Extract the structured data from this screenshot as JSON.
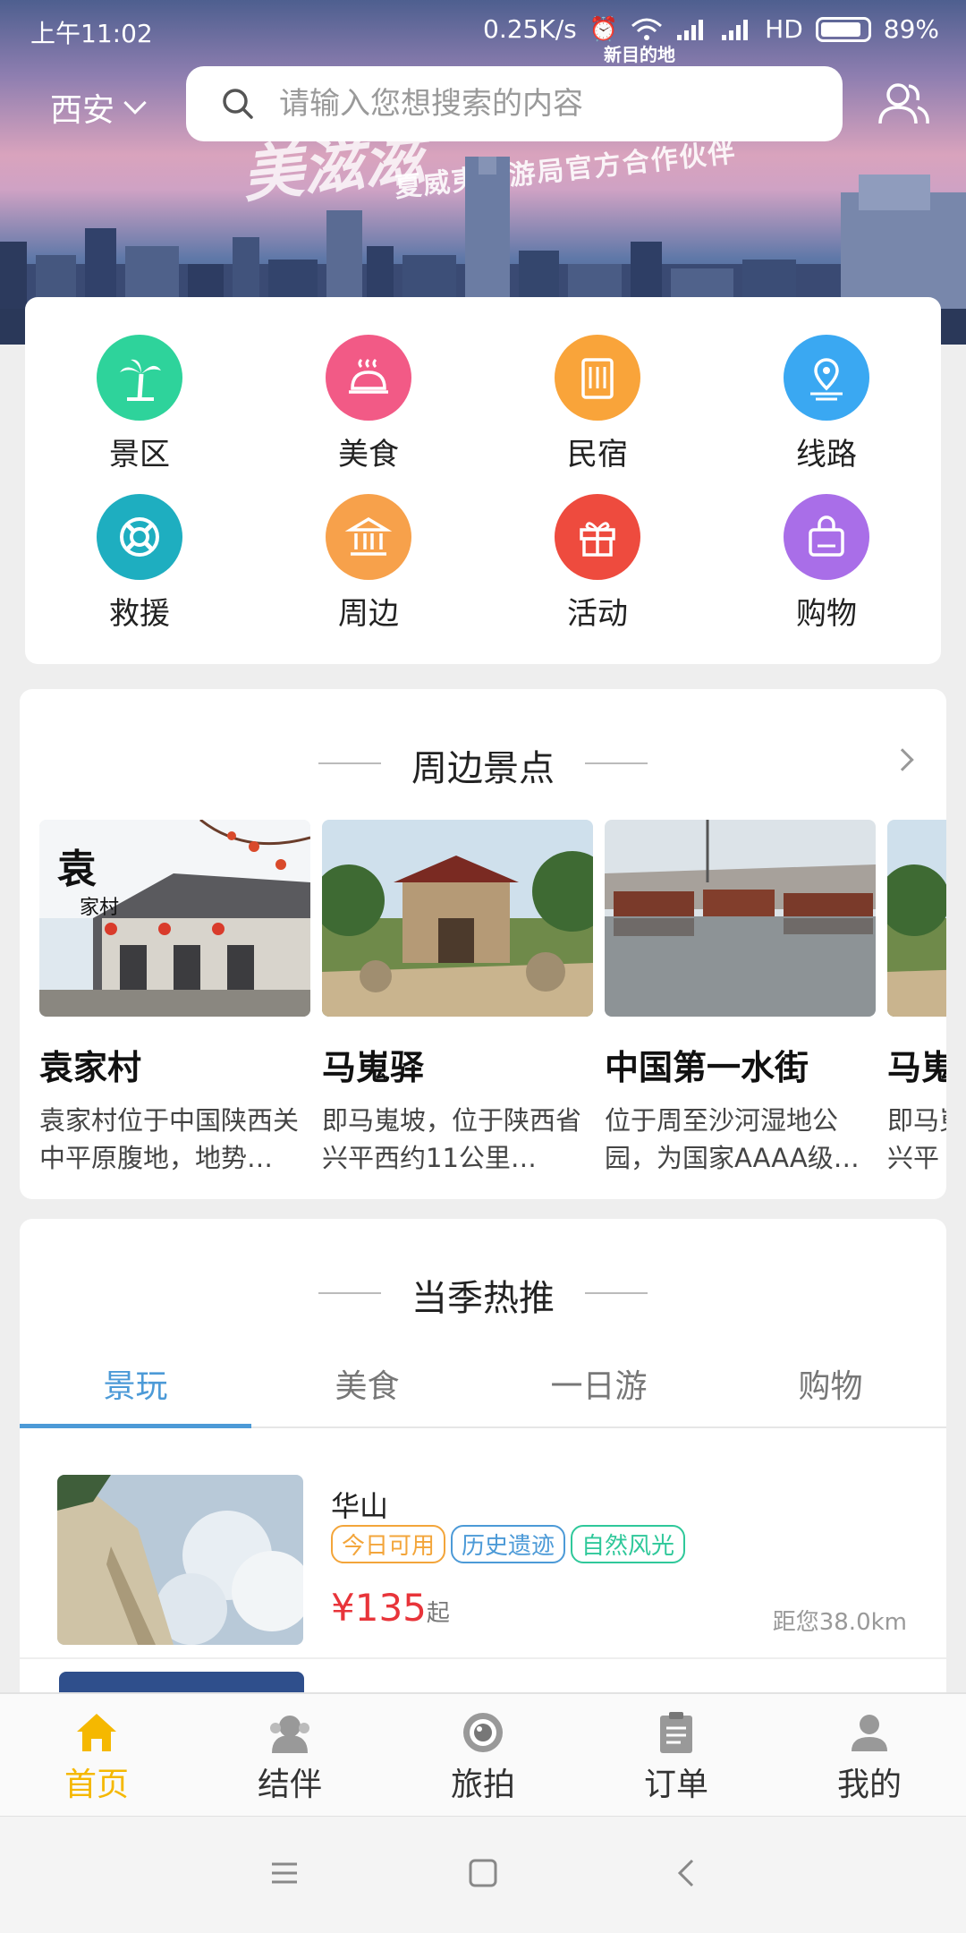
{
  "status_bar": {
    "time": "上午11:02",
    "network_speed": "0.25K/s",
    "hd": "HD",
    "battery": "89%"
  },
  "hero": {
    "banner_title": "美滋滋",
    "banner_slogan": "夏威夷旅游局官方合作伙伴",
    "banner_dest": "新目的地"
  },
  "header": {
    "city": "西安",
    "search_placeholder": "请输入您想搜索的内容"
  },
  "categories": [
    {
      "label": "景区",
      "color": "#2ed39b",
      "icon": "palm-tree-icon"
    },
    {
      "label": "美食",
      "color": "#f25a86",
      "icon": "dish-icon"
    },
    {
      "label": "民宿",
      "color": "#f9a43a",
      "icon": "building-icon"
    },
    {
      "label": "线路",
      "color": "#3aa8f2",
      "icon": "location-pin-icon"
    },
    {
      "label": "救援",
      "color": "#1eaec0",
      "icon": "lifebuoy-icon"
    },
    {
      "label": "周边",
      "color": "#f7a14b",
      "icon": "bank-icon"
    },
    {
      "label": "活动",
      "color": "#ee4b3e",
      "icon": "gift-icon"
    },
    {
      "label": "购物",
      "color": "#a96ee8",
      "icon": "shopping-bag-icon"
    }
  ],
  "nearby": {
    "title": "周边景点",
    "items": [
      {
        "name": "袁家村",
        "desc": "袁家村位于中国陕西关中平原腹地，地势…"
      },
      {
        "name": "马嵬驿",
        "desc": "即马嵬坡，位于陕西省兴平西约11公里…"
      },
      {
        "name": "中国第一水街",
        "desc": "位于周至沙河湿地公园，为国家AAAA级…"
      },
      {
        "name": "马嵬",
        "desc": "即马嵬坡，位于陕西省兴平"
      }
    ]
  },
  "seasonal": {
    "title": "当季热推",
    "tabs": [
      "景玩",
      "美食",
      "一日游",
      "购物"
    ],
    "active_tab": 0,
    "item": {
      "name": "华山",
      "tags": [
        {
          "text": "今日可用",
          "color": "#f3a53a"
        },
        {
          "text": "历史遗迹",
          "color": "#4c9ad7"
        },
        {
          "text": "自然风光",
          "color": "#2fc89a"
        }
      ],
      "price_symbol": "¥",
      "price": "135",
      "price_suffix": "起",
      "distance": "距您38.0km"
    }
  },
  "bottom_nav": [
    {
      "label": "首页",
      "icon": "home-icon",
      "active": true
    },
    {
      "label": "结伴",
      "icon": "companions-icon",
      "active": false
    },
    {
      "label": "旅拍",
      "icon": "camera-lens-icon",
      "active": false
    },
    {
      "label": "订单",
      "icon": "order-clipboard-icon",
      "active": false
    },
    {
      "label": "我的",
      "icon": "profile-icon",
      "active": false
    }
  ],
  "colors": {
    "accent_blue": "#4c9ad7",
    "nav_active": "#f5b800",
    "price_red": "#e8343a"
  }
}
